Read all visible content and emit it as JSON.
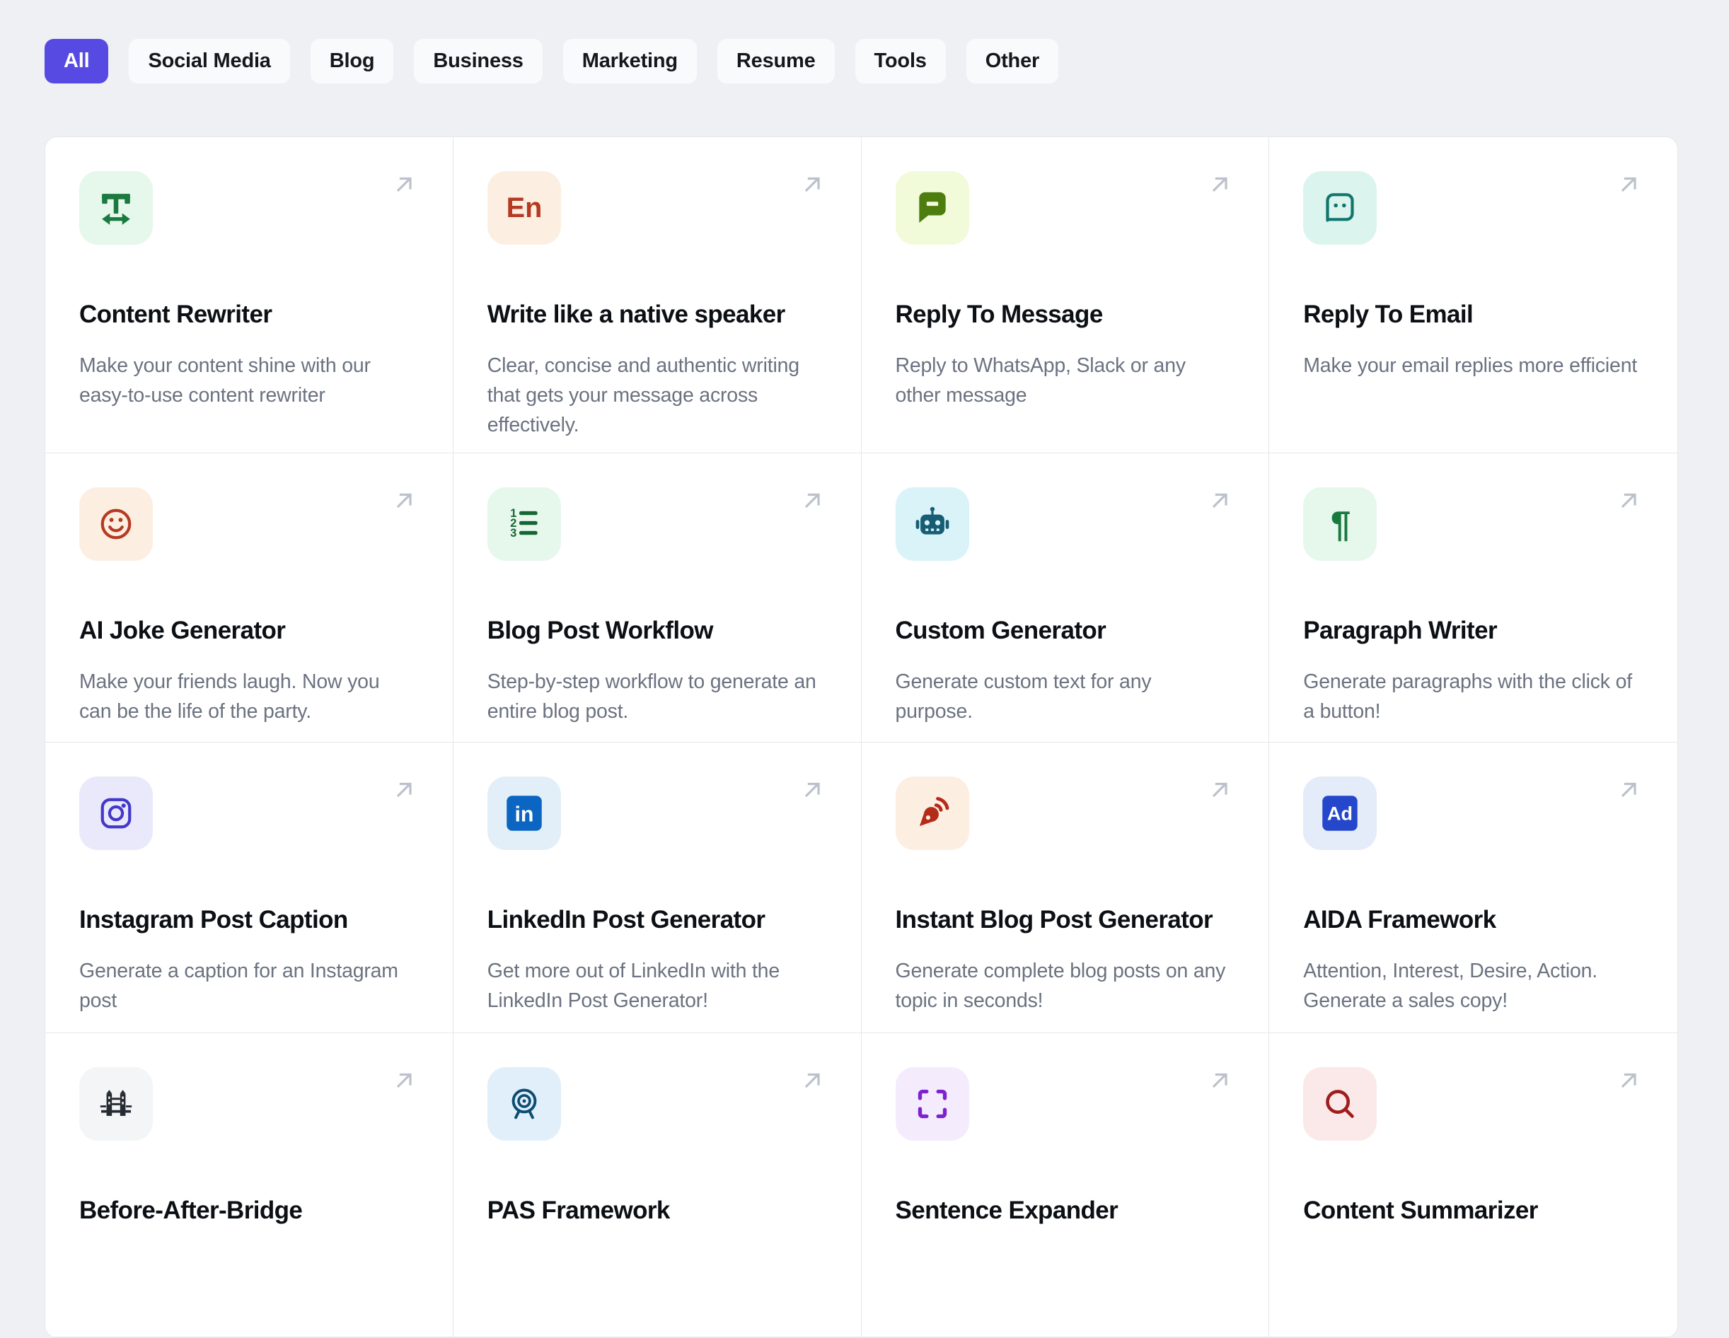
{
  "colors": {
    "page_bg": "#eef0f4",
    "accent": "#574ae2",
    "grid_border": "#e5e7eb",
    "title_color": "#0c0f14",
    "desc_color": "#6b7280",
    "arrow_color": "#bcc2cc",
    "tab_bg": "#f9fafb"
  },
  "filter_tabs": [
    {
      "label": "All",
      "active": true
    },
    {
      "label": "Social Media",
      "active": false
    },
    {
      "label": "Blog",
      "active": false
    },
    {
      "label": "Business",
      "active": false
    },
    {
      "label": "Marketing",
      "active": false
    },
    {
      "label": "Resume",
      "active": false
    },
    {
      "label": "Tools",
      "active": false
    },
    {
      "label": "Other",
      "active": false
    }
  ],
  "card_open_icon": "arrow-up-right-icon",
  "cards": [
    {
      "title": "Content Rewriter",
      "description": "Make your content shine with our easy-to-use content rewriter",
      "icon": "text-width",
      "icon_color": "#1b7a3f",
      "icon_bg": "#e6f7eb"
    },
    {
      "title": "Write like a native speaker",
      "description": "Clear, concise and authentic writing that gets your message across effectively.",
      "icon": "en-letters",
      "icon_color": "#b53a21",
      "icon_bg": "#fdeee2"
    },
    {
      "title": "Reply To Message",
      "description": "Reply to WhatsApp, Slack or any other message",
      "icon": "chat-filled",
      "icon_color": "#4d7c0f",
      "icon_bg": "#f1fad9"
    },
    {
      "title": "Reply To Email",
      "description": "Make your email replies more efficient",
      "icon": "chat-outline-face",
      "icon_color": "#0f766e",
      "icon_bg": "#dbf4ed"
    },
    {
      "title": "AI Joke Generator",
      "description": "Make your friends laugh. Now you can be the life of the party.",
      "icon": "smiley",
      "icon_color": "#b53a21",
      "icon_bg": "#fdeee2"
    },
    {
      "title": "Blog Post Workflow",
      "description": "Step-by-step workflow to generate an entire blog post.",
      "icon": "numbered-list",
      "icon_color": "#166534",
      "icon_bg": "#e6f7ec"
    },
    {
      "title": "Custom Generator",
      "description": "Generate custom text for any purpose.",
      "icon": "robot",
      "icon_color": "#175e75",
      "icon_bg": "#d9f3f8"
    },
    {
      "title": "Paragraph Writer",
      "description": "Generate paragraphs with the click of a button!",
      "icon": "pilcrow",
      "icon_color": "#187a3f",
      "icon_bg": "#e6f7ec"
    },
    {
      "title": "Instagram Post Caption",
      "description": "Generate a caption for an Instagram post",
      "icon": "instagram",
      "icon_color": "#4338ca",
      "icon_bg": "#e9e9fb"
    },
    {
      "title": "LinkedIn Post Generator",
      "description": "Get more out of LinkedIn with the LinkedIn Post Generator!",
      "icon": "linkedin-square",
      "icon_color": "#0a66c2",
      "icon_bg": "#e3eff8"
    },
    {
      "title": "Instant Blog Post Generator",
      "description": "Generate complete blog posts on any topic in seconds!",
      "icon": "pen-waves",
      "icon_color": "#b32c1a",
      "icon_bg": "#fdeee2"
    },
    {
      "title": "AIDA Framework",
      "description": "Attention, Interest, Desire, Action. Generate a sales copy!",
      "icon": "ad-square",
      "icon_color": "#2547cb",
      "icon_bg": "#e4ebf9"
    },
    {
      "title": "Before-After-Bridge",
      "description": "",
      "icon": "bridge",
      "icon_color": "#262b33",
      "icon_bg": "#f4f5f7"
    },
    {
      "title": "PAS Framework",
      "description": "",
      "icon": "target-award",
      "icon_color": "#0d4d73",
      "icon_bg": "#e1effa"
    },
    {
      "title": "Sentence Expander",
      "description": "",
      "icon": "expand-brackets",
      "icon_color": "#7e22ce",
      "icon_bg": "#f4ebfd"
    },
    {
      "title": "Content Summarizer",
      "description": "",
      "icon": "magnifier",
      "icon_color": "#9f1d1d",
      "icon_bg": "#fbe9e9"
    }
  ]
}
